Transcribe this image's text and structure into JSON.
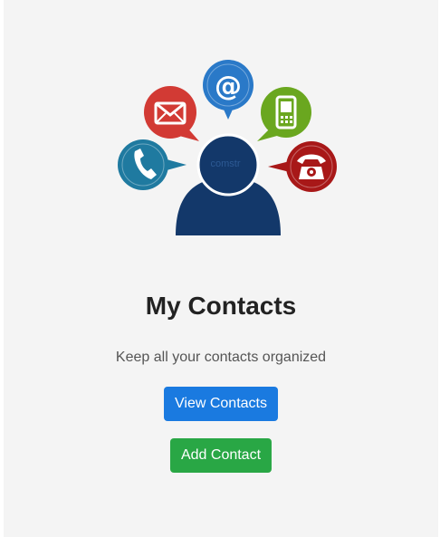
{
  "logo_watermark": "comstr",
  "page": {
    "title": "My Contacts",
    "subtitle": "Keep all your contacts organized"
  },
  "actions": {
    "view_contacts_label": "View Contacts",
    "add_contact_label": "Add Contact"
  },
  "colors": {
    "primary": "#1a7ae0",
    "success": "#29a745",
    "background": "#f4f4f4",
    "person": "#13386a"
  },
  "icons": [
    "phone-icon",
    "email-icon",
    "at-sign-icon",
    "mobile-phone-icon",
    "telephone-icon",
    "person-icon"
  ]
}
